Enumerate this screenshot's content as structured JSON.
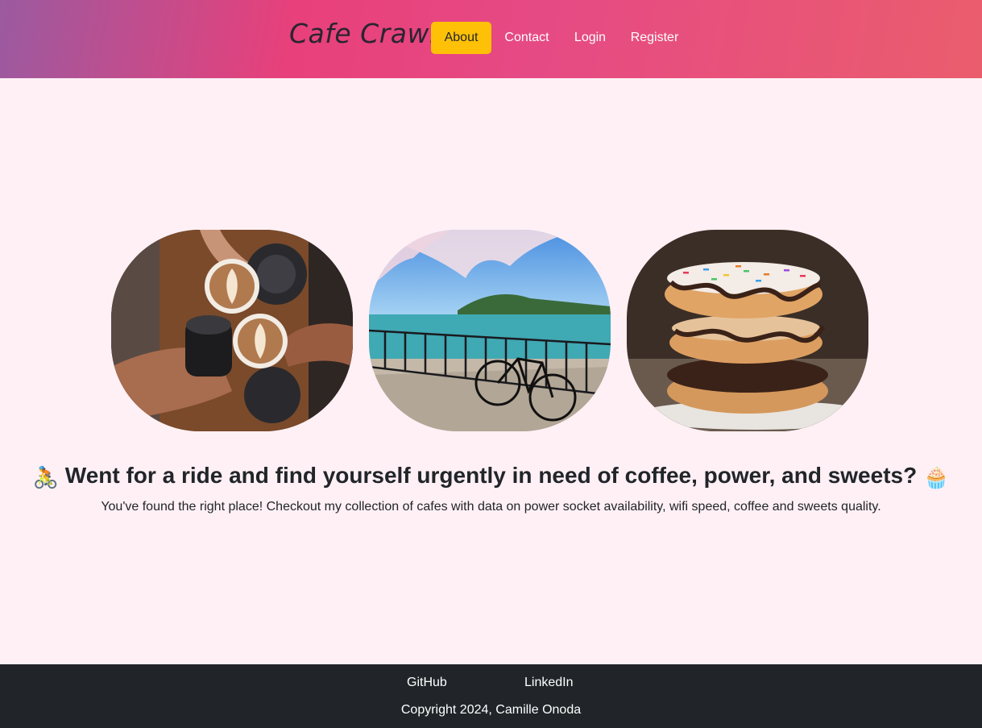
{
  "header": {
    "brand": "Cafe Crawl",
    "nav": {
      "about": "About",
      "contact": "Contact",
      "login": "Login",
      "register": "Register"
    },
    "accent_color": "#ffc107"
  },
  "gallery": {
    "images": [
      {
        "subject": "coffee-cups-cheers"
      },
      {
        "subject": "bicycle-by-lake-cherry-blossoms"
      },
      {
        "subject": "stacked-donuts"
      }
    ]
  },
  "main": {
    "emoji_left": "🚴",
    "headline": "Went for a ride and find yourself urgently in need of coffee, power, and sweets?",
    "emoji_right": "🧁",
    "subtext": "You've found the right place! Checkout my collection of cafes with data on power socket availability, wifi speed, coffee and sweets quality."
  },
  "footer": {
    "links": {
      "github": "GitHub",
      "linkedin": "LinkedIn"
    },
    "copyright": "Copyright 2024, Camille Onoda"
  }
}
